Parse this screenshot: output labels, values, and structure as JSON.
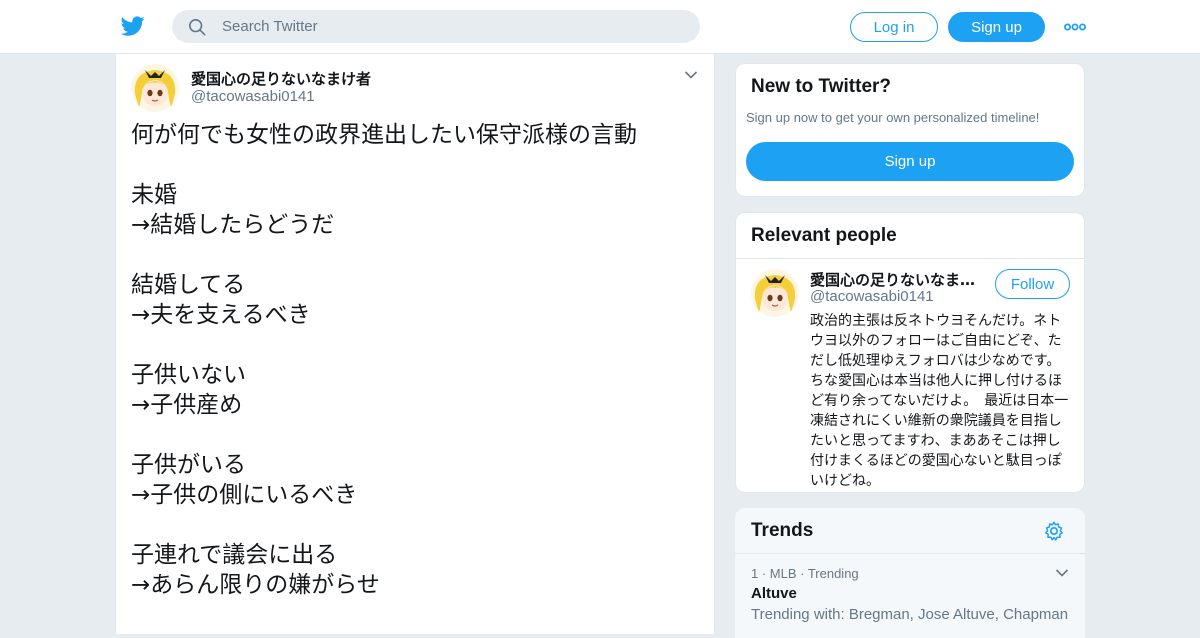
{
  "header": {
    "logo_icon": "twitter-bird-icon",
    "search_placeholder": "Search Twitter",
    "login_label": "Log in",
    "signup_label": "Sign up",
    "more_icon": "more-dots-icon",
    "accent_color": "#1da1f2"
  },
  "tweet": {
    "author_name": "愛国心の足りないなまけ者",
    "author_handle": "@tacowasabi0141",
    "text": "何が何でも女性の政界進出したい保守派様の言動\n\n未婚\n→結婚したらどうだ\n\n結婚してる\n→夫を支えるべき\n\n子供いない\n→子供産め\n\n子供がいる\n→子供の側にいるべき\n\n子連れで議会に出る\n→あらん限りの嫌がらせ"
  },
  "new_to_twitter": {
    "title": "New to Twitter?",
    "subtitle": "Sign up now to get your own personalized timeline!",
    "button_label": "Sign up"
  },
  "relevant_people": {
    "title": "Relevant people",
    "person": {
      "name": "愛国心の足りないなま…",
      "handle": "@tacowasabi0141",
      "follow_label": "Follow",
      "bio": "政治的主張は反ネトウヨそんだけ。ネトウヨ以外のフォローはご自由にどぞ、ただし低処理ゆえフォロバは少なめです。　ちな愛国心は本当は他人に押し付けるほど有り余ってないだけよ。　最近は日本一凍結されにくい維新の衆院議員を目指したいと思ってますわ、まああそこは押し付けまくるほどの愛国心ないと駄目っぽいけどね。"
    }
  },
  "trends": {
    "title": "Trends",
    "items": [
      {
        "meta": "1 · MLB · Trending",
        "name": "Altuve",
        "with": "Trending with: Bregman, Jose Altuve, Chapman"
      }
    ]
  }
}
